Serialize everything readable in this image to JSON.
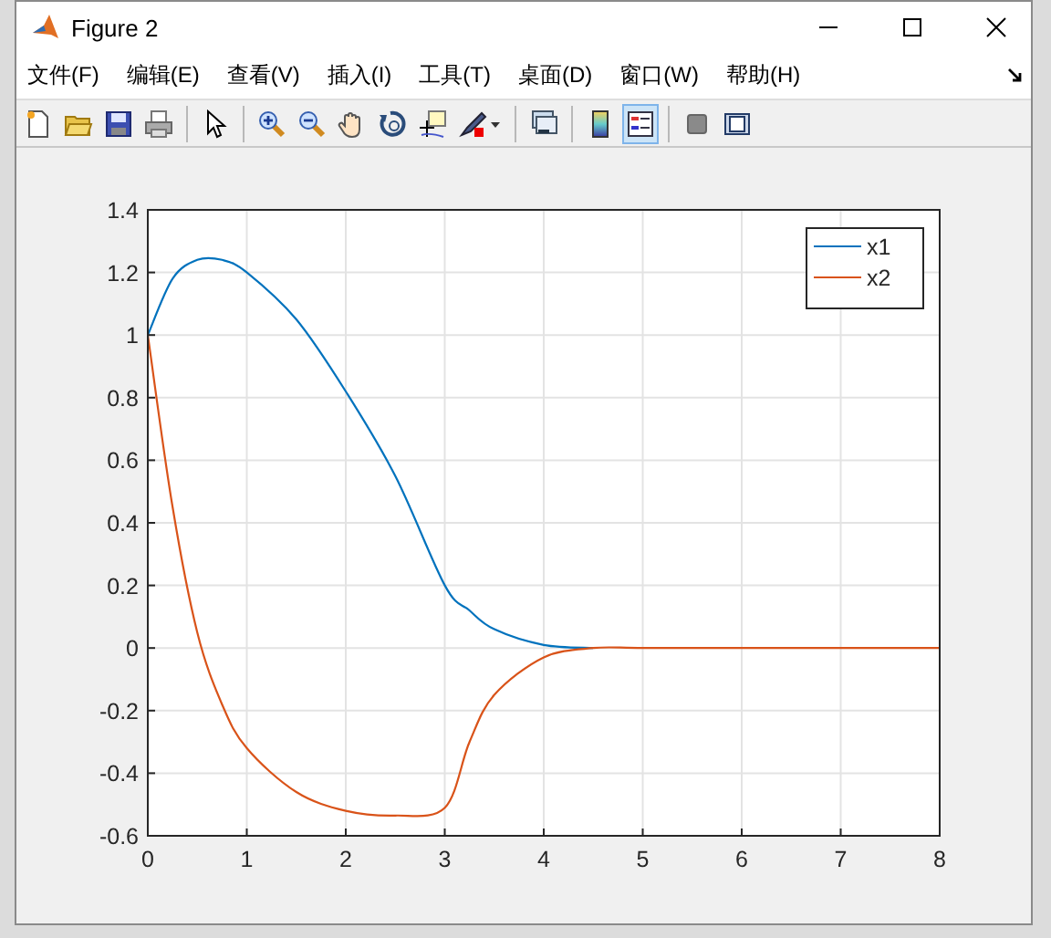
{
  "window": {
    "title": "Figure 2"
  },
  "menu": [
    "文件(F)",
    "编辑(E)",
    "查看(V)",
    "插入(I)",
    "工具(T)",
    "桌面(D)",
    "窗口(W)",
    "帮助(H)"
  ],
  "toolbar": [
    {
      "kind": "new",
      "selected": false
    },
    {
      "kind": "open",
      "selected": false
    },
    {
      "kind": "save",
      "selected": false
    },
    {
      "kind": "print",
      "selected": false
    },
    {
      "kind": "sep"
    },
    {
      "kind": "pointer",
      "selected": false
    },
    {
      "kind": "sep"
    },
    {
      "kind": "zoom-in",
      "selected": false
    },
    {
      "kind": "zoom-out",
      "selected": false
    },
    {
      "kind": "pan",
      "selected": false
    },
    {
      "kind": "rotate",
      "selected": false
    },
    {
      "kind": "cursor",
      "selected": false
    },
    {
      "kind": "brush",
      "selected": false
    },
    {
      "kind": "sep"
    },
    {
      "kind": "link",
      "selected": false
    },
    {
      "kind": "sep"
    },
    {
      "kind": "colorbar",
      "selected": false
    },
    {
      "kind": "legend",
      "selected": true
    },
    {
      "kind": "sep"
    },
    {
      "kind": "hide",
      "selected": false
    },
    {
      "kind": "show",
      "selected": false
    }
  ],
  "plot": {
    "chart_data": {
      "type": "line",
      "x": [
        0,
        0.25,
        0.5,
        0.75,
        1,
        1.5,
        2,
        2.5,
        3,
        3.25,
        3.5,
        4,
        4.5,
        5,
        6,
        7,
        8
      ],
      "series": [
        {
          "name": "x1",
          "color": "#0072bd",
          "values": [
            1,
            1.18,
            1.24,
            1.24,
            1.2,
            1.05,
            0.82,
            0.55,
            0.2,
            0.12,
            0.06,
            0.01,
            0,
            null,
            null,
            null,
            null
          ]
        },
        {
          "name": "x2",
          "color": "#d95319",
          "values": [
            1,
            0.45,
            0.05,
            -0.18,
            -0.32,
            -0.46,
            -0.52,
            -0.535,
            -0.51,
            -0.3,
            -0.15,
            -0.03,
            0,
            0,
            0,
            0,
            0
          ]
        }
      ],
      "grid": true,
      "legend": true,
      "xlim": [
        0,
        8
      ],
      "ylim": [
        -0.6,
        1.4
      ],
      "xticks": [
        0,
        1,
        2,
        3,
        4,
        5,
        6,
        7,
        8
      ],
      "yticks": [
        {
          "value": -0.6,
          "label": "-0.6"
        },
        {
          "value": -0.4,
          "label": "-0.4"
        },
        {
          "value": -0.2,
          "label": "-0.2"
        },
        {
          "value": 0,
          "label": "0"
        },
        {
          "value": 0.2,
          "label": "0.2"
        },
        {
          "value": 0.4,
          "label": "0.4"
        },
        {
          "value": 0.6,
          "label": "0.6"
        },
        {
          "value": 0.8,
          "label": "0.8"
        },
        {
          "value": 1,
          "label": "1"
        },
        {
          "value": 1.2,
          "label": "1.2"
        },
        {
          "value": 1.4,
          "label": "1.4"
        }
      ]
    }
  }
}
